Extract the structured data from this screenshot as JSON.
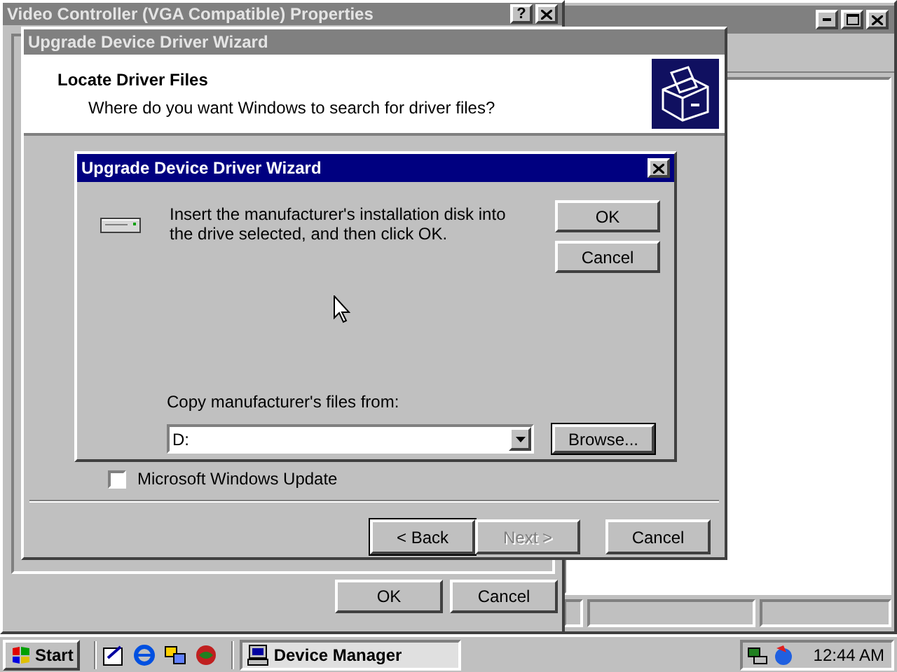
{
  "properties_window": {
    "title": "Video Controller (VGA Compatible) Properties",
    "help": "?",
    "buttons": [
      "OK",
      "Cancel"
    ]
  },
  "wizard": {
    "title": "Upgrade Device Driver Wizard",
    "heading": "Locate Driver Files",
    "subheading": "Where do you want Windows to search for driver files?",
    "option": {
      "label": "Microsoft Windows Update",
      "checked": false
    },
    "buttons": [
      {
        "label": "< Back",
        "disabled": false,
        "default": true
      },
      {
        "label": "Next >",
        "disabled": true,
        "default": false
      },
      {
        "label": "Cancel",
        "disabled": false,
        "default": false
      }
    ]
  },
  "dialog": {
    "title": "Upgrade Device Driver Wizard",
    "message": "Insert the manufacturer's installation disk into the drive selected, and then click OK.",
    "buttons": [
      {
        "label": "OK",
        "default": false
      },
      {
        "label": "Cancel",
        "default": false
      }
    ],
    "copy_label": "Copy manufacturer's files from:",
    "source": "D:",
    "browse": {
      "label": "Browse...",
      "default": true
    }
  },
  "taskbar": {
    "start": "Start",
    "tasks": [
      {
        "label": "Device Manager",
        "selected": true
      }
    ],
    "clock": "12:44 AM"
  }
}
